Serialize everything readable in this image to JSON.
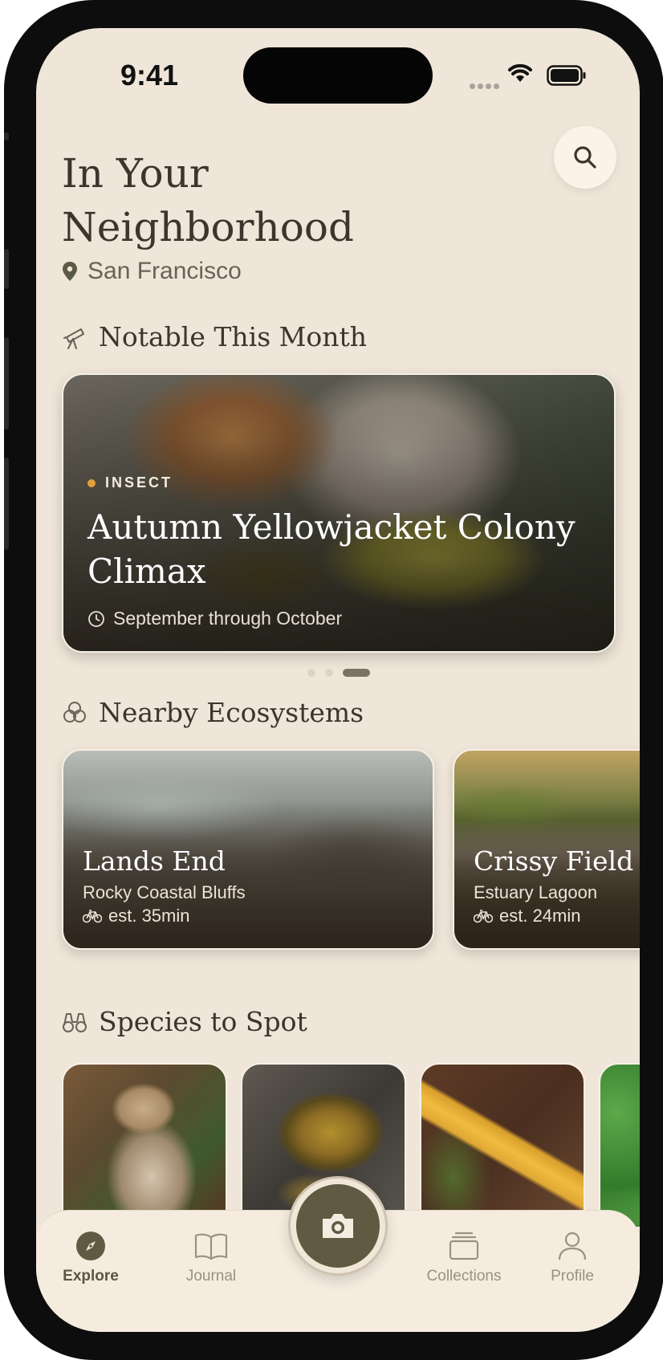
{
  "status_bar": {
    "time": "9:41"
  },
  "header": {
    "title": "In Your Neighborhood",
    "location": "San Francisco",
    "search_icon": "search-icon"
  },
  "notable": {
    "heading": "Notable This Month",
    "icon": "telescope-icon",
    "featured": {
      "tag": "INSECT",
      "title": "Autumn Yellowjacket Colony Climax",
      "period": "September through October"
    },
    "pager": {
      "count": 3,
      "active_index": 2
    }
  },
  "ecosystems": {
    "heading": "Nearby Ecosystems",
    "icon": "rings-icon",
    "items": [
      {
        "name": "Lands End",
        "type": "Rocky Coastal Bluffs",
        "time": "est. 35min"
      },
      {
        "name": "Crissy Field M",
        "type": "Estuary Lagoon",
        "time": "est. 24min"
      }
    ]
  },
  "species": {
    "heading": "Species to Spot",
    "icon": "binoculars-icon",
    "items": [
      "bobcat",
      "mushroom",
      "banana slug",
      "clover"
    ]
  },
  "tabbar": {
    "items": [
      {
        "label": "Explore",
        "icon": "compass-icon",
        "active": true
      },
      {
        "label": "Journal",
        "icon": "book-icon",
        "active": false
      },
      {
        "label": "Collections",
        "icon": "collections-icon",
        "active": false
      },
      {
        "label": "Profile",
        "icon": "person-icon",
        "active": false
      }
    ],
    "camera_icon": "camera-icon"
  },
  "colors": {
    "background": "#efe5d8",
    "accent": "#5f5a41",
    "tag_dot": "#e1a13a",
    "text": "#3b352d"
  }
}
